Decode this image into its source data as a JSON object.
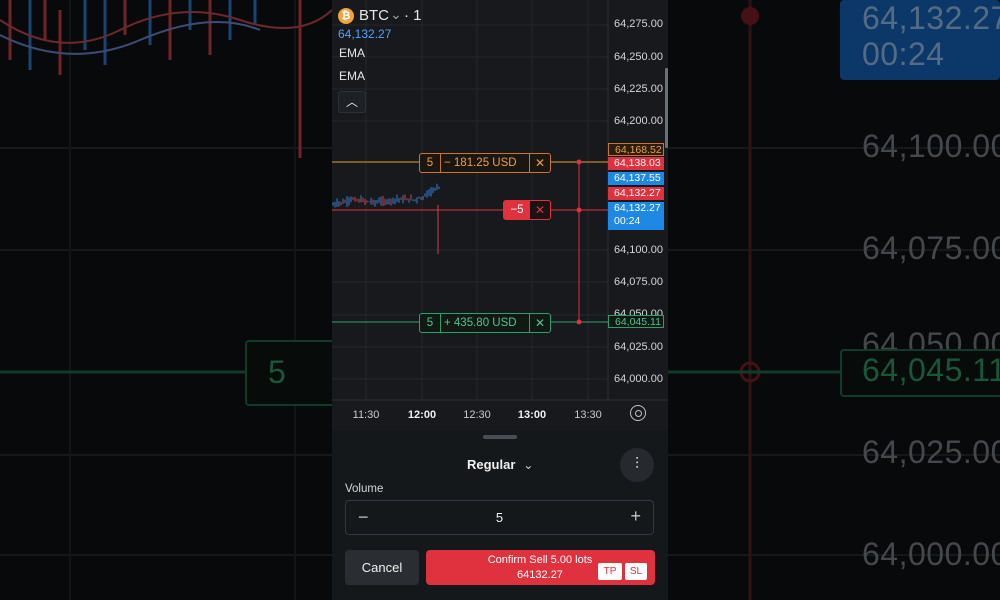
{
  "colors": {
    "accent_blue": "#1e88e5",
    "sell_red": "#e0313e",
    "take_profit_green": "#2e9e6b",
    "stop_loss_orange": "#e0a030",
    "bid_orange": "#c9762e"
  },
  "background_zoom": {
    "left_qty": "5",
    "right_price_top": "64,132.27",
    "right_time_top": "00:24",
    "right_levels": [
      "64,100.00",
      "64,075.00",
      "64,050.00",
      "64,045.11",
      "64,025.00",
      "64,000.00"
    ]
  },
  "header": {
    "symbol": "BTC",
    "coin_icon": "bitcoin-icon",
    "timeframe": "· 1",
    "current_price": "64,132.27",
    "indicators": [
      "EMA",
      "EMA"
    ],
    "collapse_icon": "chevron-up-icon"
  },
  "y_axis": {
    "labels": [
      "64,275.00",
      "64,250.00",
      "64,225.00",
      "64,200.00",
      "64,100.00",
      "64,075.00",
      "64,050.00",
      "64,025.00",
      "64,000.00"
    ]
  },
  "x_axis": {
    "labels": [
      {
        "text": "11:30",
        "bold": false
      },
      {
        "text": "12:00",
        "bold": true
      },
      {
        "text": "12:30",
        "bold": false
      },
      {
        "text": "13:00",
        "bold": true
      },
      {
        "text": "13:30",
        "bold": false
      }
    ],
    "settings_icon": "gear-icon"
  },
  "price_tags": {
    "stop_loss": "64,168.52",
    "ask": "64,138.03",
    "bid": "64,137.55",
    "sell_line": "64,132.27",
    "current": "64,132.27",
    "countdown": "00:24",
    "take_profit": "64,045.11"
  },
  "order_lines": {
    "stop_loss": {
      "qty": "5",
      "pnl": "− 181.25 USD"
    },
    "position": {
      "qty": "−5"
    },
    "take_profit": {
      "qty": "5",
      "pnl": "+ 435.80 USD"
    }
  },
  "order_panel": {
    "mode": "Regular",
    "volume_label": "Volume",
    "volume_value": "5",
    "cancel_label": "Cancel",
    "confirm_line1": "Confirm Sell 5.00 lots",
    "confirm_line2": "64132.27",
    "tp_label": "TP",
    "sl_label": "SL"
  }
}
